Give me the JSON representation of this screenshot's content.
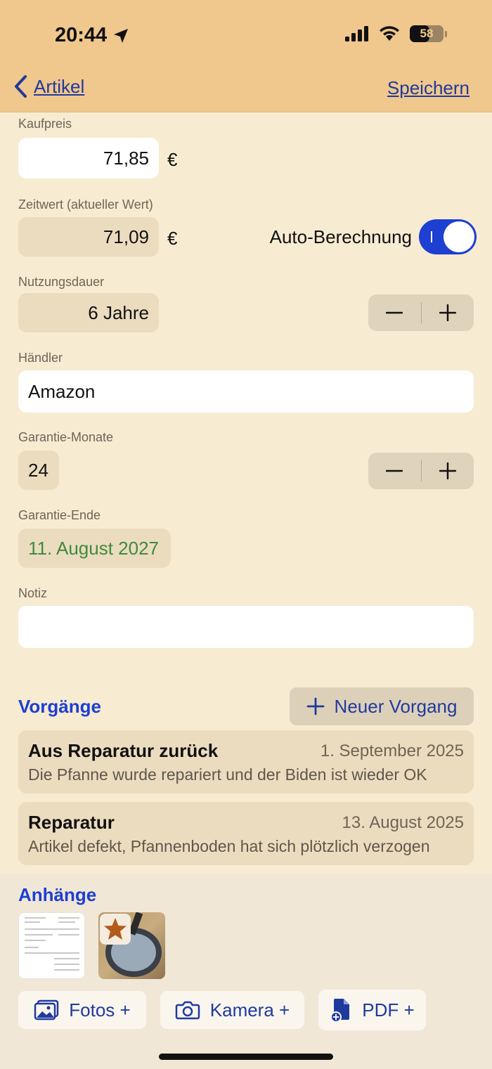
{
  "status": {
    "time": "20:44",
    "battery": "58",
    "battery_level": 0.58
  },
  "nav": {
    "back_label": "Artikel",
    "save_label": "Speichern"
  },
  "form": {
    "kaufpreis": {
      "label": "Kaufpreis",
      "value": "71,85",
      "currency": "€"
    },
    "zeitwert": {
      "label": "Zeitwert (aktueller Wert)",
      "value": "71,09",
      "currency": "€",
      "auto_label": "Auto-Berechnung",
      "auto_on": true
    },
    "nutzungsdauer": {
      "label": "Nutzungsdauer",
      "value": "6 Jahre"
    },
    "haendler": {
      "label": "Händler",
      "value": "Amazon"
    },
    "garantie_monate": {
      "label": "Garantie-Monate",
      "value": "24"
    },
    "garantie_ende": {
      "label": "Garantie-Ende",
      "value": "11. August 2027",
      "color": "#3f8a3f"
    },
    "notiz": {
      "label": "Notiz",
      "value": ""
    }
  },
  "vorgaenge": {
    "title": "Vorgänge",
    "new_button": "Neuer Vorgang",
    "items": [
      {
        "title": "Aus Reparatur zurück",
        "date": "1. September 2025",
        "description": "Die Pfanne wurde repariert und der Biden ist wieder OK"
      },
      {
        "title": "Reparatur",
        "date": "13. August 2025",
        "description": "Artikel defekt, Pfannenboden hat sich plötzlich verzogen"
      }
    ]
  },
  "anhaenge": {
    "title": "Anhänge",
    "buttons": {
      "fotos": "Fotos +",
      "kamera": "Kamera +",
      "pdf": "PDF +"
    }
  },
  "colors": {
    "header": "#f0c78c",
    "background": "#f7ebd1",
    "accent": "#1d3fd2",
    "link": "#1f3a9e"
  },
  "icons": [
    "location-arrow-icon",
    "cellular-signal-icon",
    "wifi-icon",
    "battery-icon",
    "chevron-left-icon",
    "minus-icon",
    "plus-icon",
    "star-icon",
    "photos-icon",
    "camera-icon",
    "pdf-add-icon"
  ]
}
